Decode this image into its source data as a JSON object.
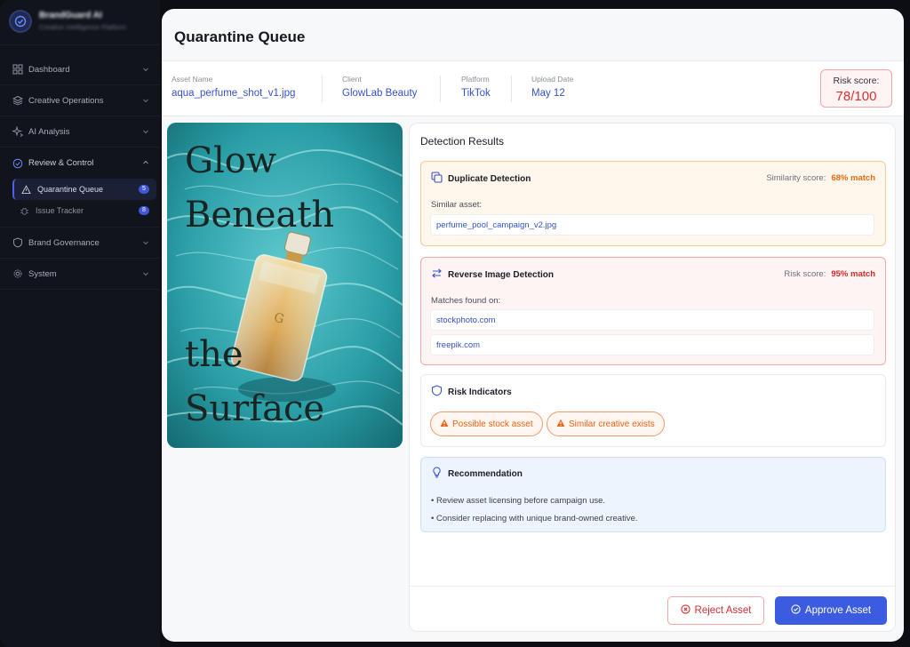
{
  "app": {
    "brand_name": "BrandGuard AI",
    "brand_subtitle": "Creative Intelligence Platform"
  },
  "sidebar": {
    "items": [
      {
        "label": "Dashboard",
        "icon": "grid-icon"
      },
      {
        "label": "Creative Operations",
        "icon": "layers-icon"
      },
      {
        "label": "AI Analysis",
        "icon": "sparkle-icon"
      },
      {
        "label": "Review & Control",
        "icon": "check-circle-icon"
      },
      {
        "label": "Brand Governance",
        "icon": "shield-icon"
      },
      {
        "label": "System",
        "icon": "gear-icon"
      }
    ],
    "sub_items": [
      {
        "label": "Quarantine Queue",
        "badge": "5",
        "icon": "warning-triangle-icon"
      },
      {
        "label": "Issue Tracker",
        "badge": "8",
        "icon": "bug-icon"
      }
    ]
  },
  "page": {
    "title": "Quarantine Queue"
  },
  "asset_info": {
    "asset_name_label": "Asset Name",
    "asset_name": "aqua_perfume_shot_v1.jpg",
    "client_label": "Client",
    "client": "GlowLab Beauty",
    "platform_label": "Platform",
    "platform": "TikTok",
    "upload_date_label": "Upload Date",
    "upload_date": "May 12",
    "risk_label": "Risk score:",
    "risk_value": "78/100"
  },
  "image": {
    "headline_line1": "Glow",
    "headline_line2": "Beneath",
    "headline_line3": "the",
    "headline_line4": "Surface",
    "bottle_monogram": "G"
  },
  "results": {
    "title": "Detection Results",
    "duplicate": {
      "title": "Duplicate Detection",
      "score_label": "Similarity score:",
      "score_value": "68% match",
      "similar_label": "Similar asset:",
      "similar_value": "perfume_pool_campaign_v2.jpg"
    },
    "reverse": {
      "title": "Reverse Image Detection",
      "score_label": "Risk score:",
      "score_value": "95% match",
      "matches_label": "Matches found on:",
      "matches": [
        "stockphoto.com",
        "freepik.com"
      ]
    },
    "risk_indicators": {
      "title": "Risk Indicators",
      "pills": [
        "Possible stock asset",
        "Similar creative exists"
      ]
    },
    "recommendation": {
      "title": "Recommendation",
      "lines": [
        "• Review asset licensing before campaign use.",
        "• Consider replacing with unique brand-owned creative."
      ]
    }
  },
  "actions": {
    "reject_label": "Reject Asset",
    "approve_label": "Approve Asset"
  },
  "colors": {
    "accent": "#3b5be0",
    "danger": "#d63232",
    "warning": "#e86a10",
    "sidebar_bg": "#11141b"
  }
}
